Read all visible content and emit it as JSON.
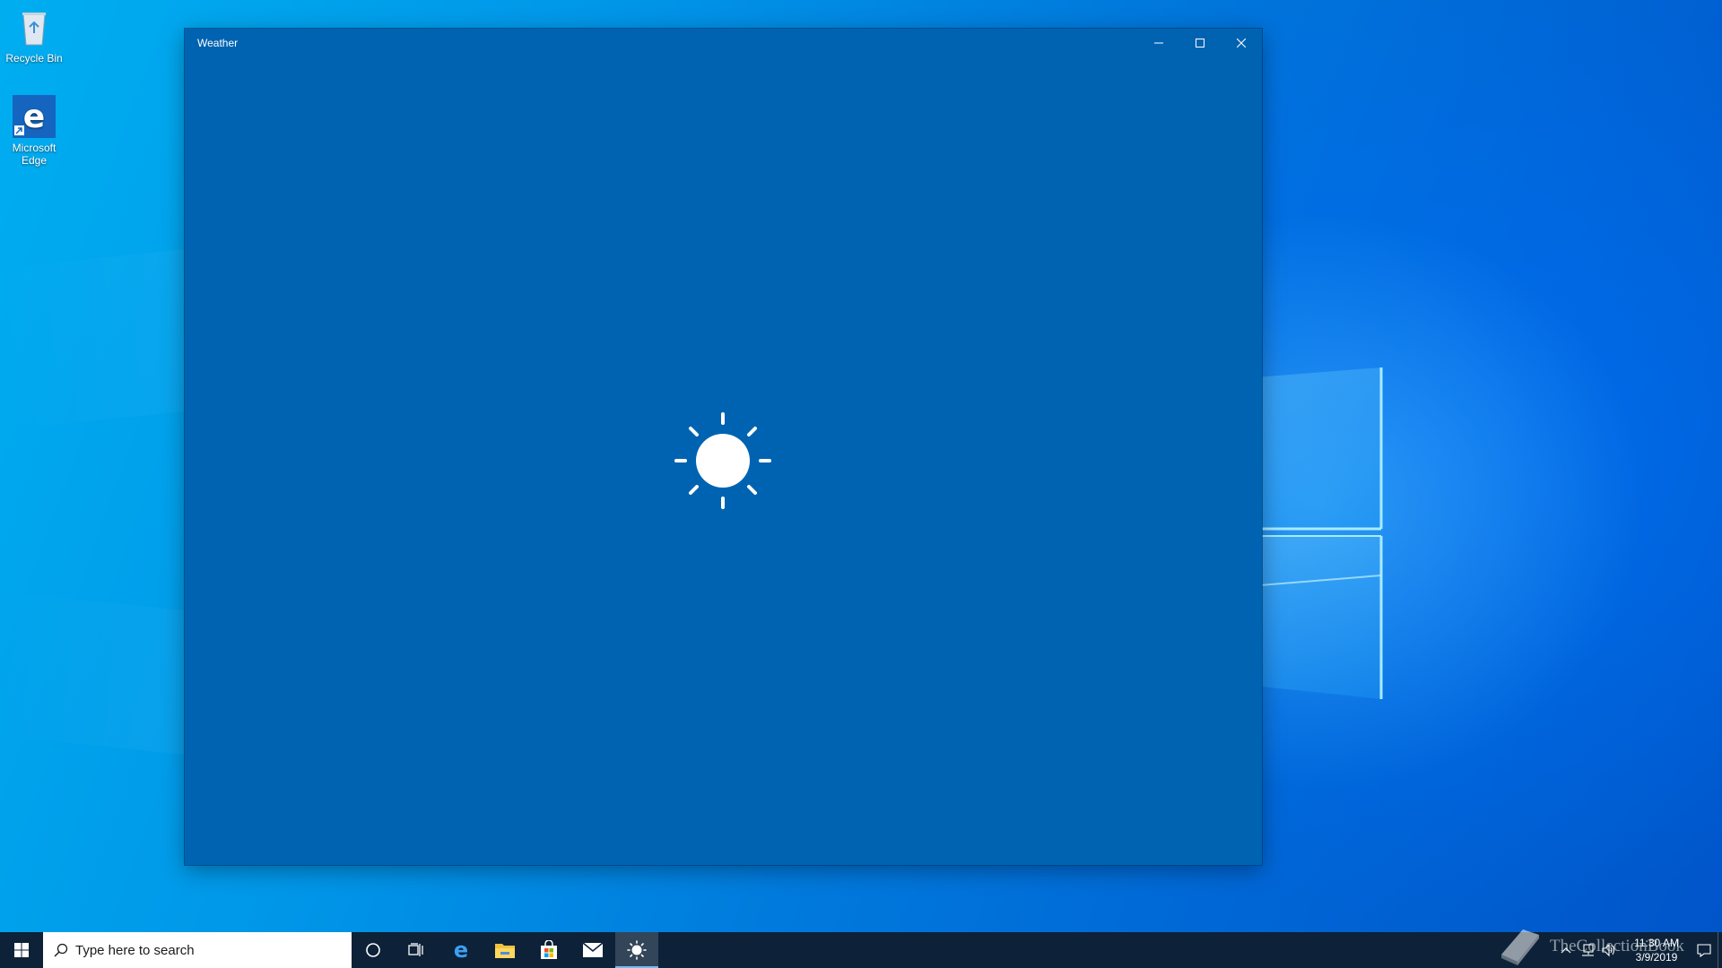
{
  "desktop": {
    "icons": [
      {
        "label": "Recycle Bin",
        "icon": "recycle-bin-icon"
      },
      {
        "label": "Microsoft Edge",
        "icon": "edge-icon"
      }
    ]
  },
  "window": {
    "title": "Weather",
    "background_color": "#0063b1",
    "splash_icon": "sun-icon",
    "controls": [
      "minimize-icon",
      "maximize-icon",
      "close-icon"
    ]
  },
  "taskbar": {
    "search_placeholder": "Type here to search",
    "apps": [
      {
        "name": "Cortana",
        "icon": "cortana-circle-icon"
      },
      {
        "name": "Task View",
        "icon": "task-view-icon"
      },
      {
        "name": "Microsoft Edge",
        "icon": "edge-icon"
      },
      {
        "name": "File Explorer",
        "icon": "folder-icon"
      },
      {
        "name": "Microsoft Store",
        "icon": "store-bag-icon"
      },
      {
        "name": "Mail",
        "icon": "mail-icon"
      },
      {
        "name": "Weather",
        "icon": "sun-icon",
        "active": true
      }
    ],
    "tray": {
      "time": "11:30 AM",
      "date": "3/9/2019"
    },
    "background_color": "#0d2238"
  },
  "watermark": {
    "text": "TheCollectionBook"
  }
}
